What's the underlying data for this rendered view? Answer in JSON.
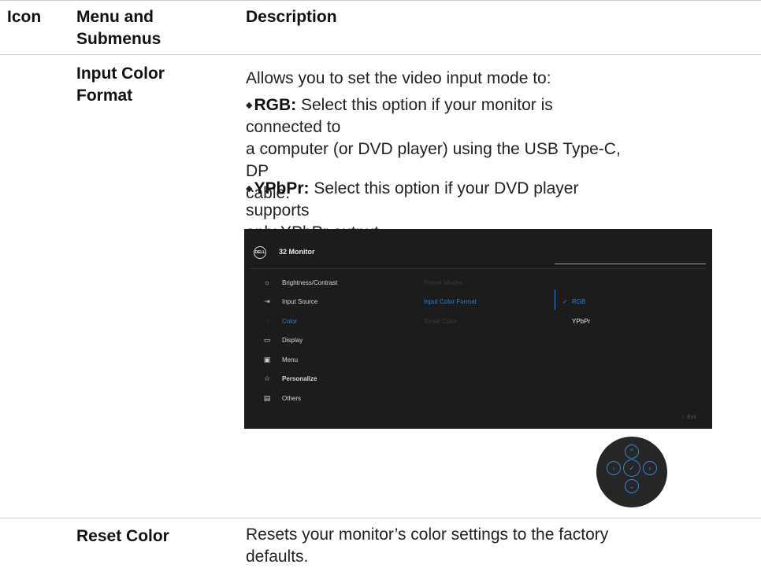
{
  "table": {
    "headers": {
      "icon": "Icon",
      "menu_line1": "Menu and",
      "menu_line2": "Submenus",
      "description": "Description"
    }
  },
  "rows": {
    "input_color_format": {
      "name_line1": "Input Color",
      "name_line2": "Format",
      "intro": "Allows you to set the video input mode to:",
      "bullets": [
        {
          "label": "RGB:",
          "text_line1": " Select this option if your monitor is connected to",
          "text_line2": "a computer (or DVD player) using the USB Type-C, DP",
          "text_line3": "cable."
        },
        {
          "label": "YPbPr:",
          "text_line1": " Select this option if your DVD player supports",
          "text_line2": "only YPbPr output."
        }
      ]
    },
    "reset_color": {
      "name": "Reset Color",
      "desc_line1": "Resets your monitor’s color settings to the factory",
      "desc_line2": "defaults."
    }
  },
  "osd": {
    "logo": "DELL",
    "title": "32 Monitor",
    "menu": [
      {
        "label": "Brightness/Contrast",
        "icon": "sun-icon"
      },
      {
        "label": "Input Source",
        "icon": "input-source-icon"
      },
      {
        "label": "Color",
        "icon": "palette-icon"
      },
      {
        "label": "Display",
        "icon": "display-icon"
      },
      {
        "label": "Menu",
        "icon": "menu-icon"
      },
      {
        "label": "Personalize",
        "icon": "star-icon"
      },
      {
        "label": "Others",
        "icon": "others-icon"
      }
    ],
    "active_menu": "Color",
    "submenu": [
      "Preset Modes",
      "Input Color Format",
      "Reset Color"
    ],
    "active_submenu": "Input Color Format",
    "options": [
      "RGB",
      "YPbPr"
    ],
    "selected_option": "RGB",
    "exit_label": "Exit"
  },
  "colors": {
    "accent": "#2a7fd8",
    "osd_background": "#1c1c1c",
    "rule": "#cfcfcf"
  }
}
